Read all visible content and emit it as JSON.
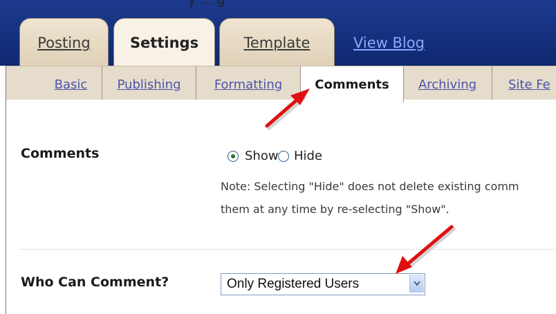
{
  "page_caption": "y ... g",
  "main_tabs": [
    {
      "label": "Posting",
      "active": false
    },
    {
      "label": "Settings",
      "active": true
    },
    {
      "label": "Template",
      "active": false
    }
  ],
  "view_blog": "View Blog",
  "subtabs": [
    {
      "label": "Basic"
    },
    {
      "label": "Publishing"
    },
    {
      "label": "Formatting"
    },
    {
      "label": "Comments",
      "active": true
    },
    {
      "label": "Archiving"
    },
    {
      "label": "Site Fe"
    }
  ],
  "comments": {
    "label": "Comments",
    "options": [
      {
        "label": "Show",
        "selected": true
      },
      {
        "label": "Hide",
        "selected": false
      }
    ],
    "note_line1": "Note: Selecting \"Hide\" does not delete existing comm",
    "note_line2": "them at any time by re-selecting \"Show\"."
  },
  "who_can_comment": {
    "label": "Who Can Comment?",
    "selected": "Only Registered Users"
  },
  "colors": {
    "header": "#15307e",
    "subnav": "#e6dccc",
    "link": "#4a55a8",
    "arrow": "#e01010"
  }
}
